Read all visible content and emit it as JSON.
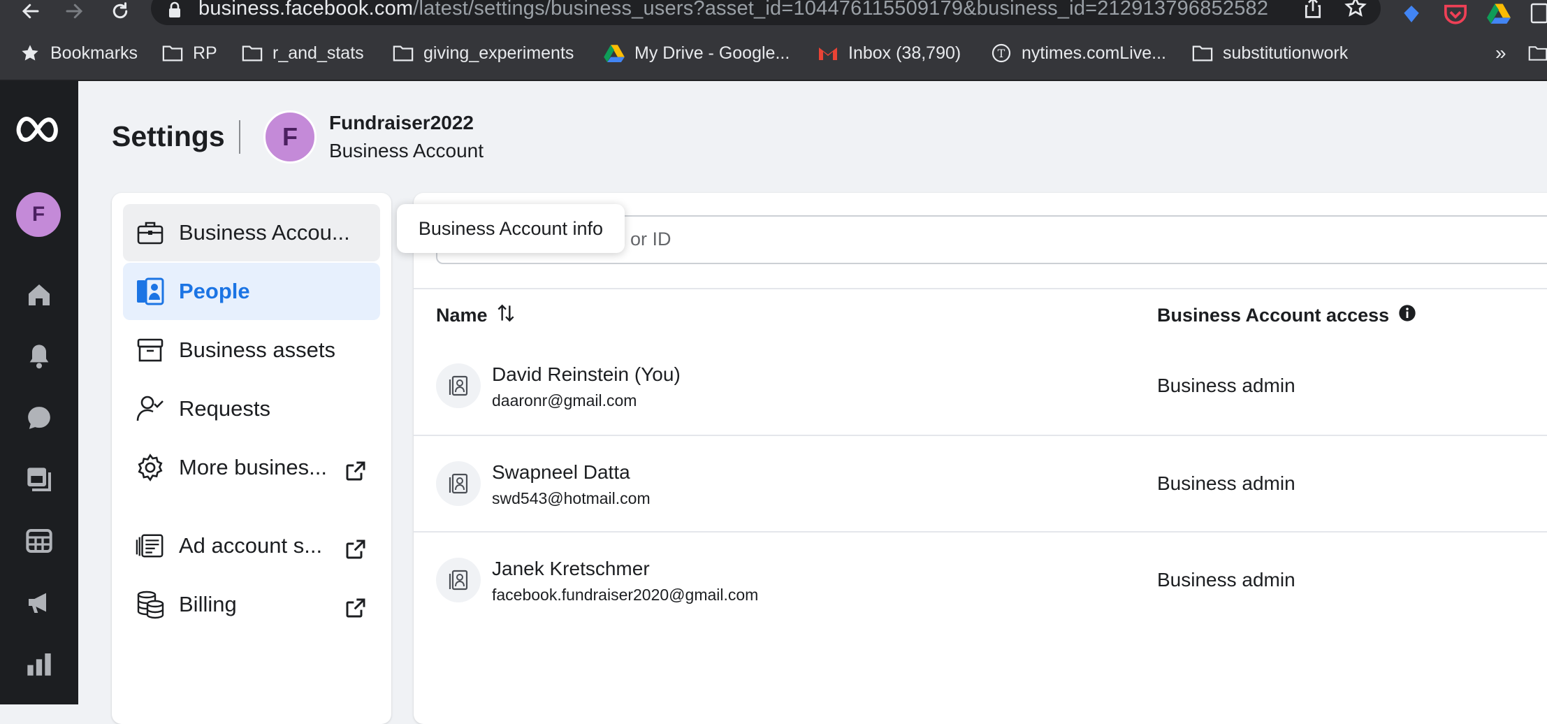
{
  "browser": {
    "url_host": "business.facebook.com",
    "url_path": "/latest/settings/business_users?asset_id=104476115509179&business_id=212913796852582",
    "bookmarks": [
      {
        "label": "Bookmarks",
        "icon": "star-icon"
      },
      {
        "label": "RP",
        "icon": "folder-icon"
      },
      {
        "label": "r_and_stats",
        "icon": "folder-icon"
      },
      {
        "label": "giving_experiments",
        "icon": "folder-icon"
      },
      {
        "label": "My Drive - Google...",
        "icon": "google-drive-icon"
      },
      {
        "label": "Inbox (38,790)",
        "icon": "gmail-icon"
      },
      {
        "label": "nytimes.comLive...",
        "icon": "nytimes-icon"
      },
      {
        "label": "substitutionwork",
        "icon": "folder-icon"
      }
    ],
    "overflow": "»"
  },
  "rail": {
    "avatar_letter": "F"
  },
  "header": {
    "title": "Settings",
    "avatar_letter": "F",
    "business_name": "Fundraiser2022",
    "business_type": "Business Account"
  },
  "nav": {
    "items": [
      {
        "label": "Business Accou...",
        "icon": "briefcase-icon",
        "state": "hover"
      },
      {
        "label": "People",
        "icon": "people-icon",
        "state": "active"
      },
      {
        "label": "Business assets",
        "icon": "archive-box-icon"
      },
      {
        "label": "Requests",
        "icon": "person-check-icon"
      },
      {
        "label": "More busines...",
        "icon": "gear-icon",
        "external": true
      },
      {
        "label": "Ad account s...",
        "icon": "ad-account-icon",
        "external": true
      },
      {
        "label": "Billing",
        "icon": "billing-coins-icon",
        "external": true
      }
    ]
  },
  "tooltip": "Business Account info",
  "search": {
    "visible_placeholder_fragment": "or ID"
  },
  "table": {
    "columns": {
      "name": "Name",
      "access": "Business Account access"
    },
    "rows": [
      {
        "name": "David Reinstein (You)",
        "email": "daaronr@gmail.com",
        "access": "Business admin"
      },
      {
        "name": "Swapneel Datta",
        "email": "swd543@hotmail.com",
        "access": "Business admin"
      },
      {
        "name": "Janek Kretschmer",
        "email": "facebook.fundraiser2020@gmail.com",
        "access": "Business admin"
      }
    ]
  },
  "colors": {
    "accent": "#1b74e4",
    "avatar": "#c48ad8",
    "rail": "#1c1e21",
    "chrome": "#35363a"
  }
}
